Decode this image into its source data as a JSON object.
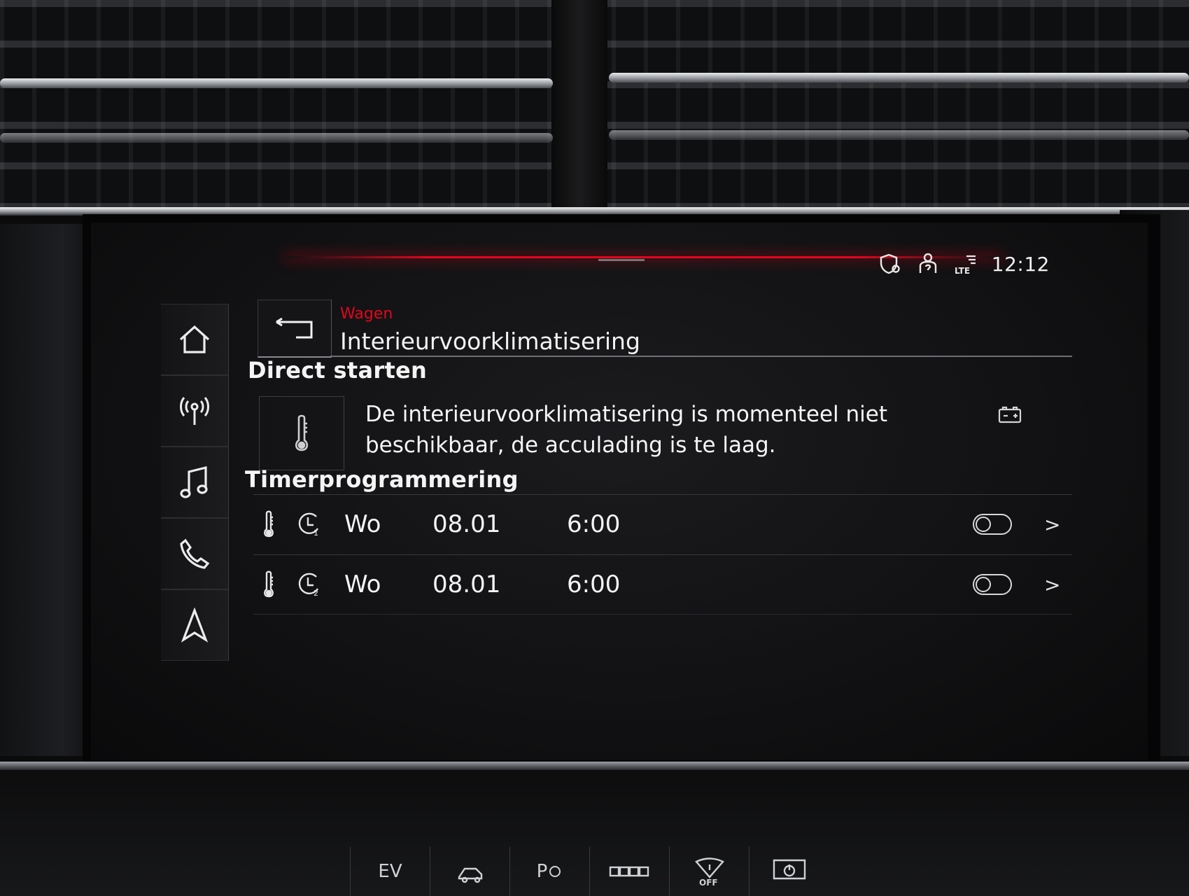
{
  "statusbar": {
    "clock": "12:12",
    "icons": [
      "privacy-shield-icon",
      "user-help-icon",
      "lte-signal-icon"
    ],
    "lte_label": "LTE"
  },
  "nav": {
    "items": [
      "home-icon",
      "antenna-icon",
      "music-note-icon",
      "phone-icon",
      "navigation-arrow-icon"
    ]
  },
  "header": {
    "breadcrumb": "Wagen",
    "title": "Interieurvoorklimatisering"
  },
  "direct_start": {
    "heading": "Direct starten",
    "message": "De interieurvoorklimatisering is momenteel niet beschikbaar, de acculading is te laag."
  },
  "timers": {
    "heading": "Timerprogrammering",
    "rows": [
      {
        "timer_number": "1",
        "day": "Wo",
        "date": "08.01",
        "time": "6:00",
        "enabled": false
      },
      {
        "timer_number": "2",
        "day": "Wo",
        "date": "08.01",
        "time": "6:00",
        "enabled": false
      }
    ]
  },
  "console": {
    "ev_label": "EV",
    "off_label": "OFF",
    "p_label": "P"
  },
  "colors": {
    "accent_red": "#e1071c",
    "text": "#f4f4f4",
    "screen_bg": "#111113"
  }
}
